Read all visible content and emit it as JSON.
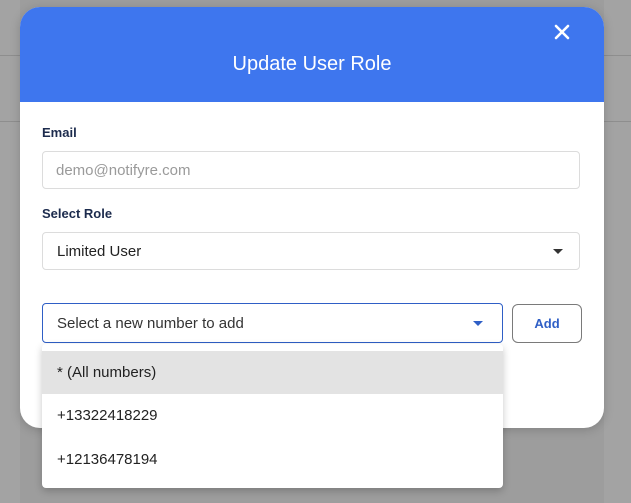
{
  "modal": {
    "title": "Update User Role"
  },
  "email": {
    "label": "Email",
    "placeholder": "demo@notifyre.com",
    "value": ""
  },
  "role": {
    "label": "Select Role",
    "selected": "Limited User"
  },
  "number_select": {
    "placeholder": "Select a new number to add",
    "options": [
      "* (All numbers)",
      "+13322418229",
      "+12136478194"
    ],
    "highlighted_index": 0
  },
  "add_button": {
    "label": "Add"
  },
  "colors": {
    "header": "#3e76ee",
    "accent": "#2f5fc6",
    "backdrop": "#9d9d9d"
  },
  "icons": {
    "close": "close-icon",
    "role_caret": "chevron-down-icon",
    "number_caret": "chevron-down-icon"
  }
}
